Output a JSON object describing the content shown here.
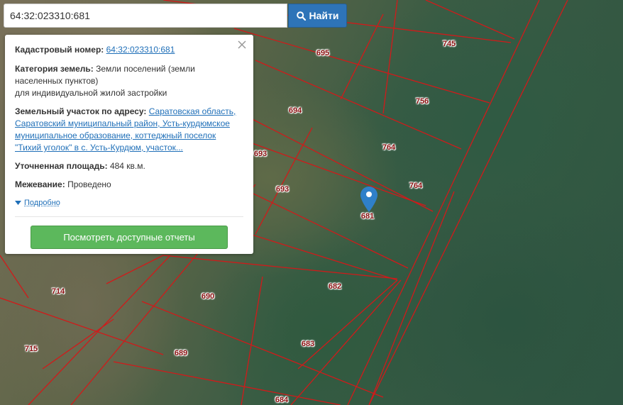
{
  "search": {
    "value": "64:32:023310:681",
    "button_label": "Найти",
    "button_icon": "search-icon"
  },
  "info_panel": {
    "cadastral_label": "Кадастровый номер:",
    "cadastral_number": "64:32:023310:681",
    "category_label": "Категория земель:",
    "category_value": "Земли поселений (земли населенных пунктов)",
    "category_use": "для индивидуальной жилой застройки",
    "address_label": "Земельный участок по адресу:",
    "address_value": "Саратовская область, Саратовский муниципальный район, Усть-курдюмское муниципальное образование, коттеджный поселок \"Тихий уголок\" в с. Усть-Курдюм, участок...",
    "area_label": "Уточненная площадь:",
    "area_value": "484 кв.м.",
    "survey_label": "Межевание:",
    "survey_value": "Проведено",
    "details_label": "Подробно",
    "reports_button": "Посмотреть доступные отчеты",
    "close_icon": "close-icon"
  },
  "map": {
    "parcel_labels": [
      "695",
      "745",
      "694",
      "756",
      "693",
      "764",
      "693",
      "764",
      "681",
      "714",
      "690",
      "682",
      "715",
      "689",
      "683",
      "684"
    ],
    "boundary_color": "#d11a1a",
    "marker_color": "#2f80c9"
  }
}
